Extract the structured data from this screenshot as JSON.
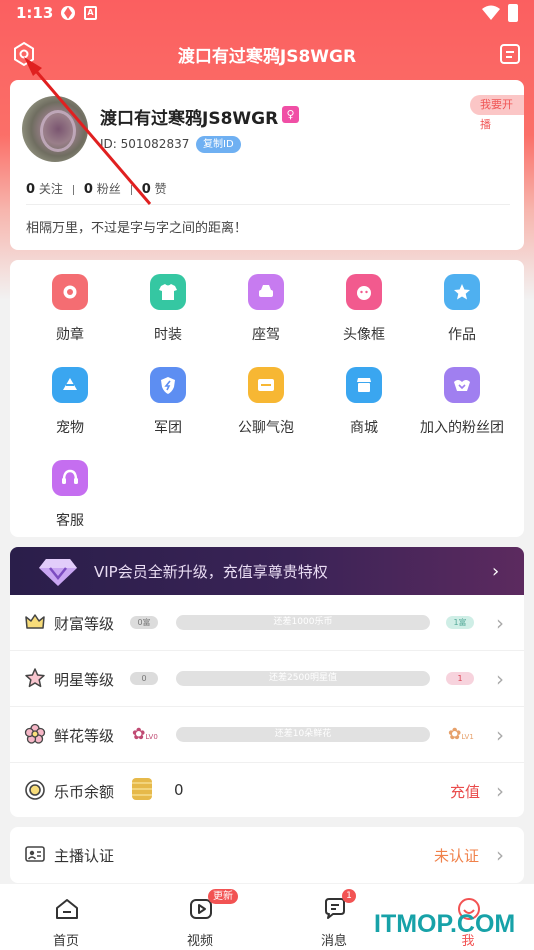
{
  "status_bar": {
    "time": "1:13"
  },
  "header": {
    "title": "渡口有过寒鸦JS8WGR"
  },
  "profile": {
    "name": "渡口有过寒鸦JS8WGR",
    "id_text": "ID: 501082837",
    "copy_id": "复制ID",
    "go_live": "我要开播",
    "stats": [
      {
        "count": "0",
        "label": "关注"
      },
      {
        "count": "0",
        "label": "粉丝"
      },
      {
        "count": "0",
        "label": "赞"
      }
    ],
    "bio": "相隔万里，不过是字与字之间的距离！"
  },
  "features": [
    {
      "label": "勋章",
      "icon": "medal-icon",
      "color": "#f46d72"
    },
    {
      "label": "时装",
      "icon": "tshirt-icon",
      "color": "#35c7a2"
    },
    {
      "label": "座驾",
      "icon": "car-icon",
      "color": "#c77bf0"
    },
    {
      "label": "头像框",
      "icon": "avatar-frame-icon",
      "color": "#f25a8e"
    },
    {
      "label": "作品",
      "icon": "star-icon",
      "color": "#4fb0f0"
    },
    {
      "label": "宠物",
      "icon": "pet-icon",
      "color": "#3aa6f0"
    },
    {
      "label": "军团",
      "icon": "shield-icon",
      "color": "#5d8ef2"
    },
    {
      "label": "公聊气泡",
      "icon": "chat-bubble-icon",
      "color": "#f7b733"
    },
    {
      "label": "商城",
      "icon": "shop-icon",
      "color": "#3aa6f0"
    },
    {
      "label": "加入的粉丝团",
      "icon": "fan-club-icon",
      "color": "#a07ff0"
    },
    {
      "label": "客服",
      "icon": "headset-icon",
      "color": "#c56ef0"
    }
  ],
  "vip": {
    "text": "VIP会员全新升级，充值享尊贵特权"
  },
  "levels": [
    {
      "label": "财富等级",
      "icon": "crown-icon",
      "left_badge": "0富",
      "right_badge": "1富",
      "bar_text": "还差1000乐币"
    },
    {
      "label": "明星等级",
      "icon": "star-outline-icon",
      "left_badge": "0",
      "right_badge": "1",
      "bar_text": "还差2500明星值"
    },
    {
      "label": "鲜花等级",
      "icon": "flower-icon",
      "left_badge": "LV0",
      "right_badge": "LV1",
      "bar_text": "还差10朵鲜花"
    }
  ],
  "balance": {
    "label": "乐币余额",
    "value": "0",
    "action": "充值"
  },
  "certification": {
    "label": "主播认证",
    "status": "未认证"
  },
  "tabs": [
    {
      "label": "首页",
      "icon": "home-icon"
    },
    {
      "label": "视频",
      "icon": "video-icon",
      "badge": "更新"
    },
    {
      "label": "消息",
      "icon": "message-icon",
      "badge": "1"
    },
    {
      "label": "我",
      "icon": "me-icon"
    }
  ],
  "watermark": "ITMOP.COM",
  "colors": {
    "brand": "#fb5f60",
    "accent_pink": "#f04fa5",
    "copy_blue": "#6fb0f2",
    "recharge_red": "#e94b4b",
    "cert_orange": "#f0814a",
    "watermark": "#17a2a8"
  }
}
